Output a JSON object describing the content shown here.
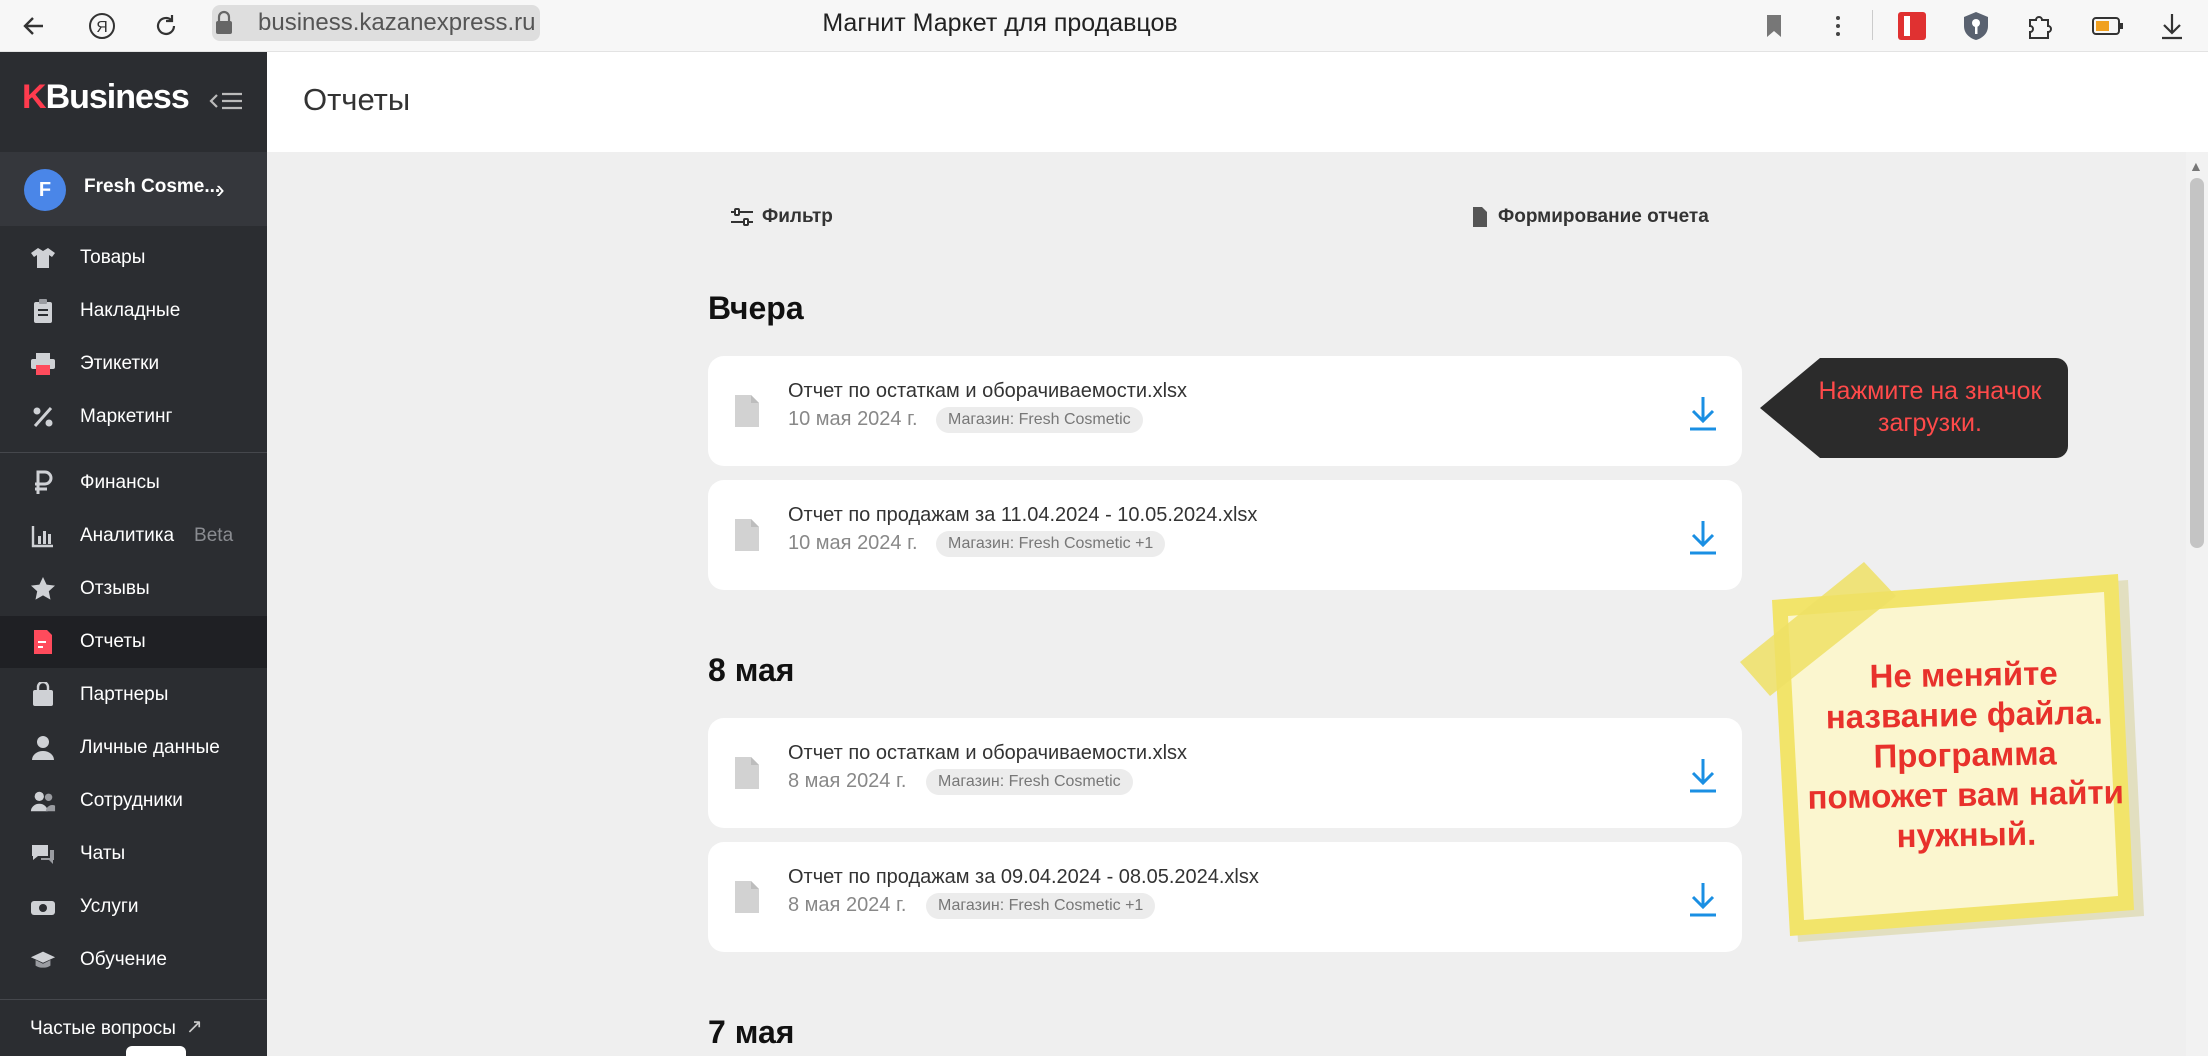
{
  "browser": {
    "url": "business.kazanexpress.ru",
    "page_title": "Магнит Маркет для продавцов"
  },
  "sidebar": {
    "logo_letter": "K",
    "logo_text": "Business",
    "shop": {
      "avatar_letter": "F",
      "name": "Fresh Cosme..."
    },
    "items": [
      {
        "label": "Товары",
        "icon": "shirt-icon"
      },
      {
        "label": "Накладные",
        "icon": "clipboard-icon"
      },
      {
        "label": "Этикетки",
        "icon": "printer-icon"
      },
      {
        "label": "Маркетинг",
        "icon": "percent-icon"
      },
      {
        "label": "Финансы",
        "icon": "ruble-icon"
      },
      {
        "label": "Аналитика",
        "icon": "bar-chart-icon",
        "badge": "Beta"
      },
      {
        "label": "Отзывы",
        "icon": "star-icon"
      },
      {
        "label": "Отчеты",
        "icon": "report-icon",
        "active": true
      },
      {
        "label": "Партнеры",
        "icon": "bag-icon"
      },
      {
        "label": "Личные данные",
        "icon": "person-icon"
      },
      {
        "label": "Сотрудники",
        "icon": "people-icon"
      },
      {
        "label": "Чаты",
        "icon": "chat-icon"
      },
      {
        "label": "Услуги",
        "icon": "services-icon"
      },
      {
        "label": "Обучение",
        "icon": "graduation-cap-icon"
      }
    ],
    "faq_label": "Частые вопросы"
  },
  "header": {
    "title": "Отчеты"
  },
  "toolbar": {
    "filter_label": "Фильтр",
    "generate_label": "Формирование отчета"
  },
  "sections": [
    {
      "title": "Вчера",
      "reports": [
        {
          "name": "Отчет по остаткам и оборачиваемости.xlsx",
          "date": "10 мая 2024 г.",
          "badge": "Магазин: Fresh Cosmetic"
        },
        {
          "name": "Отчет по продажам за 11.04.2024 - 10.05.2024.xlsx",
          "date": "10 мая 2024 г.",
          "badge": "Магазин: Fresh Cosmetic +1"
        }
      ]
    },
    {
      "title": "8 мая",
      "reports": [
        {
          "name": "Отчет по остаткам и оборачиваемости.xlsx",
          "date": "8 мая 2024 г.",
          "badge": "Магазин: Fresh Cosmetic"
        },
        {
          "name": "Отчет по продажам за 09.04.2024 - 08.05.2024.xlsx",
          "date": "8 мая 2024 г.",
          "badge": "Магазин: Fresh Cosmetic +1"
        }
      ]
    },
    {
      "title": "7 мая",
      "reports": []
    }
  ],
  "annotations": {
    "callout": "Нажмите на значок загрузки.",
    "sticky_note": "Не меняйте название файла. Программа поможет вам найти нужный."
  },
  "colors": {
    "sidebar_bg": "#2b2d31",
    "accent_red": "#ff3b4e",
    "download_blue": "#1a8fe3",
    "callout_text": "#ff4a4a",
    "sticky_bg": "#fbf6cf"
  }
}
